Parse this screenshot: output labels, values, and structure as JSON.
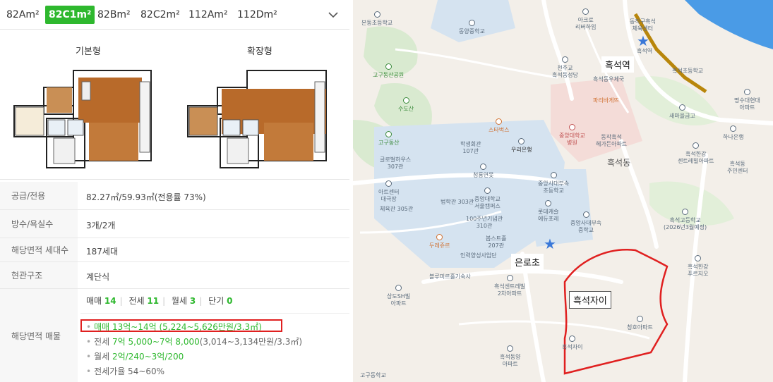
{
  "tabs": {
    "items": [
      "82Am²",
      "82C1m²",
      "82Bm²",
      "82C2m²",
      "112Am²",
      "112Dm²"
    ],
    "active_index": 1
  },
  "plans": {
    "basic_title": "기본형",
    "extended_title": "확장형"
  },
  "info": {
    "supply_label": "공급/전용",
    "supply_value": "82.27㎡/59.93㎡(전용률 73%)",
    "rooms_label": "방수/욕실수",
    "rooms_value": "3개/2개",
    "households_label": "해당면적 세대수",
    "households_value": "187세대",
    "entrance_label": "현관구조",
    "entrance_value": "계단식",
    "listings_label": "해당면적 매물",
    "counts": {
      "sale_label": "매매",
      "sale_count": "14",
      "jeonse_label": "전세",
      "jeonse_count": "11",
      "monthly_label": "월세",
      "monthly_count": "3",
      "short_label": "단기",
      "short_count": "0"
    },
    "sale_line": "매매 13억~14억 (5,224~5,626만원/3.3㎡)",
    "jeonse_prefix": "전세 ",
    "jeonse_range": "7억 5,000~7억 8,000",
    "jeonse_suffix": "(3,014~3,134만원/3.3㎡)",
    "monthly_prefix": "월세 ",
    "monthly_range": "2억/240~3억/200",
    "ratio_line": "전세가율 54~60%"
  },
  "map": {
    "labels": {
      "heukseok_station": "흑석역",
      "eunro_school": "은로초",
      "heukseok_xi": "흑석자이",
      "bondong_elem": "본동초등학교",
      "dongyang_mid": "동양중학교",
      "acro_river": "아크로\n리버하임",
      "dongjak_center": "동작구흑석\n체육센터",
      "heukseok_station_small": "흑석역",
      "cheonju_church": "천주교\n흑석동성당",
      "woori_bank_top": "흑석동우체국",
      "heukseok_elem": "흑석초등학교",
      "myungsoo_apt": "명수대현대\n아파트",
      "gogu_park": "고구동산공원",
      "sudosan": "수도산",
      "paris": "파리바게뜨",
      "semaul": "새마을금고",
      "hana_bank": "하나은행",
      "starbucks": "스타벅스",
      "cau_hospital": "중앙대학교\n병원",
      "heukseok_hangang": "동작흑석\n헤가든아파트",
      "gogu_dongsan": "고구동산",
      "hakseng": "학생회관\n107관",
      "woori_bank": "우리은행",
      "heukseok_dong": "흑석동",
      "centreville": "흑석한강\n센트레빌아파트",
      "heukseok_center": "흑석동\n주민센터",
      "global": "글로벌하우스\n307관",
      "cheongryong": "청룡연못",
      "cau_elem": "중앙사대부속\n초등학교",
      "art_center": "아트센터\n대극장",
      "lib": "법학관 303관",
      "cau_seoul": "중앙대학교\n서울캠퍼스",
      "lotte": "롯데캐슬\n에듀포레",
      "cau_mid": "중앙사대부속\n중학교",
      "heukseok_high": "흑석고등학교\n(2026년3월예정)",
      "jeyuk": "체육관 305관",
      "centennial": "100주년기념관\n310관",
      "dream": "두레쥬르",
      "buse": "봅스트홀\n207관",
      "inryuk": "인력양성사업단",
      "heukseok_river": "흑석한강\n푸르지오",
      "blue": "블루미르홀기숙사",
      "centreville2": "흑석센트레빌\n2차아파트",
      "sangdo": "상도SH빌\n아파트",
      "cheongho": "청호아파트",
      "xi_small": "흑석자이",
      "dongyang_apt": "흑석동양\n아파트",
      "gogu_school": "고구동학교"
    }
  },
  "colors": {
    "accent_green": "#2eb82e",
    "highlight_red": "#e02020",
    "river_blue": "#4a9be6",
    "campus_blue": "#d5e3f0",
    "park_green": "#d9ead0",
    "star_blue": "#3a78d8",
    "subway_line": "#b8860b"
  }
}
